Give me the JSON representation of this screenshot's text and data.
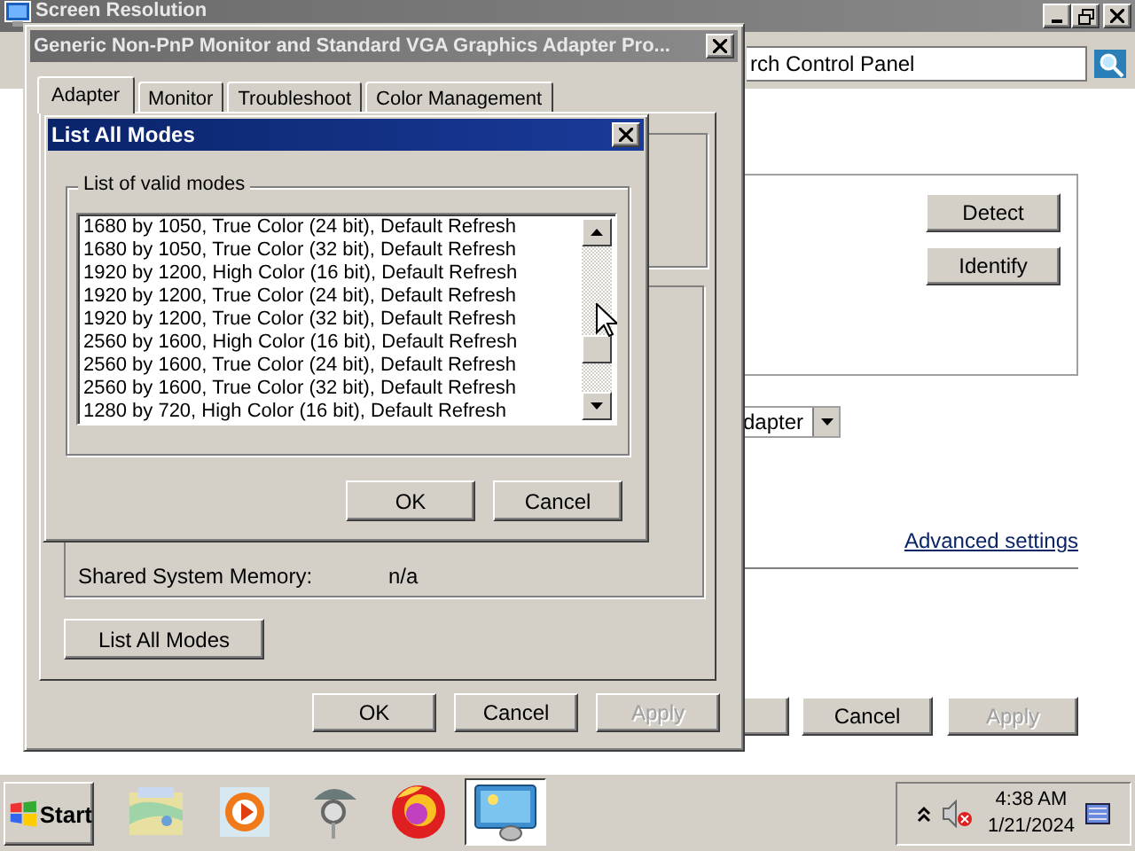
{
  "back_window": {
    "title": "Screen Resolution",
    "address": "rch Control Panel",
    "buttons": [
      {
        "label": "Detect"
      },
      {
        "label": "Identify"
      }
    ],
    "dropdown": {
      "value": "dapter"
    },
    "link": "Advanced settings",
    "footer_buttons": [
      {
        "label": "Cancel",
        "disabled": false
      },
      {
        "label": "Apply",
        "disabled": true
      }
    ]
  },
  "properties": {
    "title": "Generic Non-PnP Monitor and Standard VGA Graphics Adapter Pro...",
    "active": false,
    "tabs": [
      {
        "label": "Adapter",
        "selected": true
      },
      {
        "label": "Monitor",
        "selected": false
      },
      {
        "label": "Troubleshoot",
        "selected": false
      },
      {
        "label": "Color Management",
        "selected": false
      }
    ],
    "rows": [
      {
        "label": "Shared System Memory:",
        "value": "n/a"
      }
    ],
    "list_button": "List All Modes",
    "buttons": [
      {
        "label": "OK",
        "disabled": false
      },
      {
        "label": "Cancel",
        "disabled": false
      },
      {
        "label": "Apply",
        "disabled": true
      }
    ]
  },
  "modes_dialog": {
    "title": "List All Modes",
    "active": true,
    "group_label": "List of valid modes",
    "modes": [
      "1680 by 1050, True Color (24 bit), Default Refresh",
      "1680 by 1050, True Color (32 bit), Default Refresh",
      "1920 by 1200, High Color (16 bit), Default Refresh",
      "1920 by 1200, True Color (24 bit), Default Refresh",
      "1920 by 1200, True Color (32 bit), Default Refresh",
      "2560 by 1600, High Color (16 bit), Default Refresh",
      "2560 by 1600, True Color (24 bit), Default Refresh",
      "2560 by 1600, True Color (32 bit), Default Refresh",
      "1280 by 720, High Color (16 bit), Default Refresh"
    ],
    "buttons": [
      {
        "label": "OK"
      },
      {
        "label": "Cancel"
      }
    ]
  },
  "taskbar": {
    "start": "Start",
    "apps": [
      {
        "kind": "map",
        "active": false
      },
      {
        "kind": "media",
        "active": false
      },
      {
        "kind": "pin",
        "active": false
      },
      {
        "kind": "browser",
        "active": false
      },
      {
        "kind": "display",
        "active": true
      }
    ],
    "time": "4:38 AM",
    "date": "1/21/2024"
  }
}
